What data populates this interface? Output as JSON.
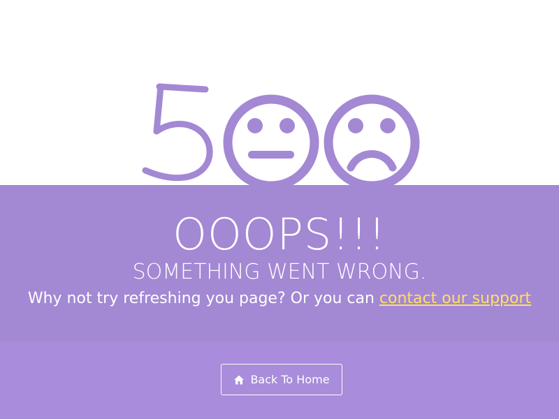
{
  "error": {
    "code_graphic": {
      "digit": "5",
      "faces": [
        "neutral-face-icon",
        "sad-face-icon"
      ],
      "color": "#a388d4"
    },
    "headline": "OOOPS!!!",
    "subheadline": "SOMETHING WENT WRONG.",
    "message_prefix": "Why not try refreshing you page? Or you can ",
    "support_link": "contact our support"
  },
  "actions": {
    "home_button_label": "Back To Home",
    "home_icon": "home-icon"
  },
  "colors": {
    "band": "#a388d4",
    "footer": "#a98cdb",
    "link": "#ffe066",
    "text": "#ffffff"
  }
}
